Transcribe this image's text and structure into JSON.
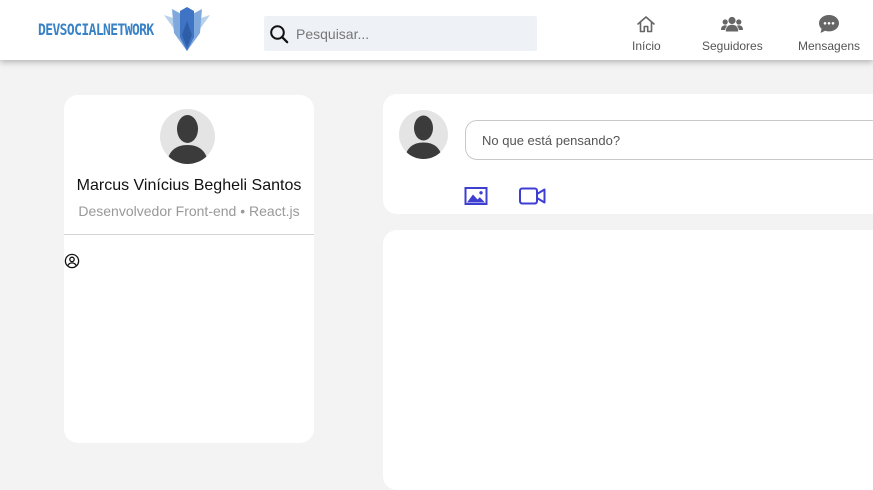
{
  "header": {
    "logo_text": "DEVSOCIALNETWORK",
    "search": {
      "placeholder": "Pesquisar..."
    },
    "nav": [
      {
        "label": "Início",
        "icon": "home-icon"
      },
      {
        "label": "Seguidores",
        "icon": "users-icon"
      },
      {
        "label": "Mensagens",
        "icon": "chat-bubble-icon"
      }
    ]
  },
  "profile": {
    "name": "Marcus Vinícius Begheli Santos",
    "role": "Desenvolvedor Front-end • React.js",
    "avatar_icon": "default-avatar-icon",
    "user_icon": "user-circle-icon"
  },
  "composer": {
    "placeholder": "No que está pensando?",
    "actions": [
      {
        "icon": "image-icon"
      },
      {
        "icon": "video-camera-icon"
      }
    ]
  },
  "colors": {
    "accent": "#3d3fd1",
    "logo": "#3a82c6",
    "background": "#f3f3f3",
    "card": "#ffffff",
    "search_bg": "#eef1f5"
  }
}
